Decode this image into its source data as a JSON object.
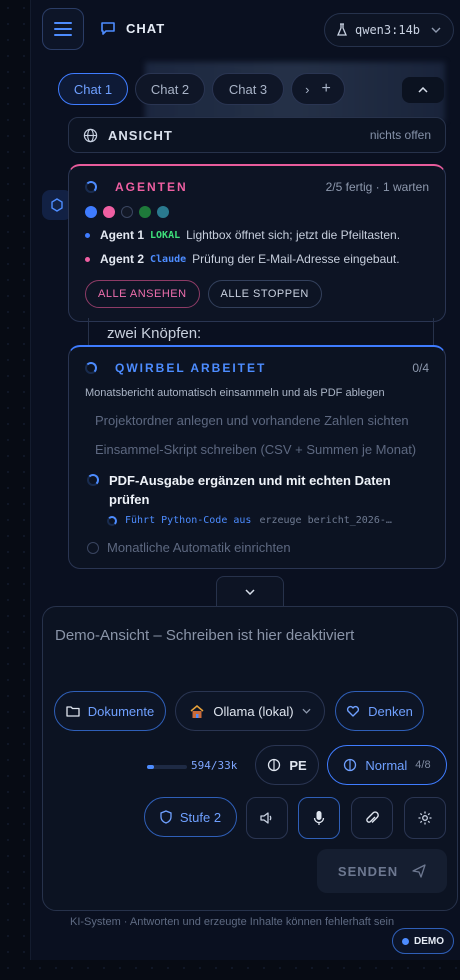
{
  "colors": {
    "accent": "#4d8cff",
    "pink": "#ef5fa2",
    "background": "#0a1020",
    "card": "#0c1322"
  },
  "header": {
    "menu_icon": "hamburger-menu-icon",
    "chat_icon": "chat-bubble-icon",
    "title": "CHAT",
    "model": {
      "icon": "flask-icon",
      "name": "qwen3:14b",
      "chevron": "chevron-down-icon"
    }
  },
  "tabs": {
    "items": [
      {
        "label": "Chat 1",
        "active": true
      },
      {
        "label": "Chat 2",
        "active": false
      },
      {
        "label": "Chat 3",
        "active": false
      }
    ],
    "more_label": "›",
    "add_label": "+",
    "collapse_icon": "chevron-up-icon"
  },
  "ansicht": {
    "icon": "globe-icon",
    "label": "ANSICHT",
    "status": "nichts offen"
  },
  "agents": {
    "title": "AGENTEN",
    "progress": "2/5 fertig · 1 warten",
    "dots": [
      {
        "state": "running",
        "color": "#3f7cff"
      },
      {
        "state": "running",
        "color": "#ef5fa2"
      },
      {
        "state": "waiting",
        "color": "#1a2030"
      },
      {
        "state": "done",
        "color": "#1e7a3a"
      },
      {
        "state": "done",
        "color": "#2a7a8f"
      }
    ],
    "list": [
      {
        "name": "Agent 1",
        "tag": "LOKAL",
        "tag_color": "#3ee07a",
        "bullet_color": "#3f7cff",
        "desc": "Lightbox öffnet sich; jetzt die Pfeiltasten."
      },
      {
        "name": "Agent 2",
        "tag": "Claude",
        "tag_color": "#4d8cff",
        "bullet_color": "#ef5fa2",
        "desc": "Prüfung der E-Mail-Adresse eingebaut."
      }
    ],
    "view_all_label": "ALLE ANSEHEN",
    "stop_all_label": "ALLE STOPPEN"
  },
  "behind_message": "zwei Knöpfen:",
  "qwirbel": {
    "title": "QWIRBEL ARBEITET",
    "progress": "0/4",
    "task": "Monatsbericht automatisch einsammeln und als PDF ablegen",
    "steps_done": [
      "Projektordner anlegen und vorhandene Zahlen sichten",
      "Einsammel-Skript schreiben (CSV + Summen je Monat)"
    ],
    "step_active": "PDF-Ausgabe ergänzen und mit echten Daten prüfen",
    "subtask": {
      "label": "Führt Python-Code aus",
      "detail": "erzeuge bericht_2026-…"
    },
    "step_pending": "Monatliche Automatik einrichten"
  },
  "composer": {
    "placeholder": "Demo-Ansicht – Schreiben ist hier deaktiviert",
    "documents_label": "Dokumente",
    "model_label": "Ollama (lokal)",
    "think_label": "Denken",
    "tokens": "594/33k",
    "token_fraction": 0.018,
    "pe_label": "PE",
    "mode_label": "Normal",
    "mode_count": "4/8",
    "level_label": "Stufe 2",
    "send_label": "SENDEN"
  },
  "footer": {
    "note": "KI-System · Antworten und erzeugte Inhalte können fehlerhaft sein",
    "demo_label": "DEMO"
  }
}
